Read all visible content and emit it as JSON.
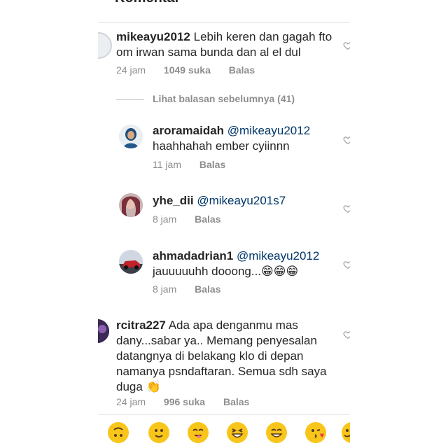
{
  "header": {
    "title": "Komentar"
  },
  "comments": [
    {
      "username": "mikeayu2012",
      "text_line1": "Lebih keren dan gagah fto",
      "text_line2": "om irwan sama bunda dan al el dul",
      "time": "24 jam",
      "likes": "1049 suka",
      "reply": "Balas"
    },
    {
      "username": "rcitra227",
      "text_line1": "Ada apa denganmu mas",
      "text_line2": "dany...sabar ya.. Memang penyesalan",
      "text_line3": "datangnya di belakang klo di depan",
      "text_line4": "namanya psndaftaran. Semua sdh saya",
      "text_line5": "duga 👏",
      "time": "24 jam",
      "likes": "996 suka",
      "reply": "Balas"
    }
  ],
  "view_previous": "Lihat balasan sebelumnya (41)",
  "replies": [
    {
      "username": "aroramaidah",
      "mention": "@mikeayu2012",
      "text": "haahhahah ember cyiinnn",
      "time": "11 jam",
      "reply": "Balas"
    },
    {
      "username": "yhe_dii",
      "mention": "@mikeayu201s7",
      "text": "",
      "time": "8 jam",
      "reply": "Balas"
    },
    {
      "username": "ahmadadrian1",
      "mention": "@mikeayu2012",
      "text": "jauuuuuhh dooong...😁😁😁",
      "time": "8 jam",
      "reply": "Balas"
    }
  ],
  "emoji_bar": {
    "items": [
      "upside-down-face",
      "smiling-face",
      "smiling-face-with-tongue",
      "grinning-squinting-face",
      "grinning-face",
      "kissing-face",
      "partial-face"
    ]
  }
}
